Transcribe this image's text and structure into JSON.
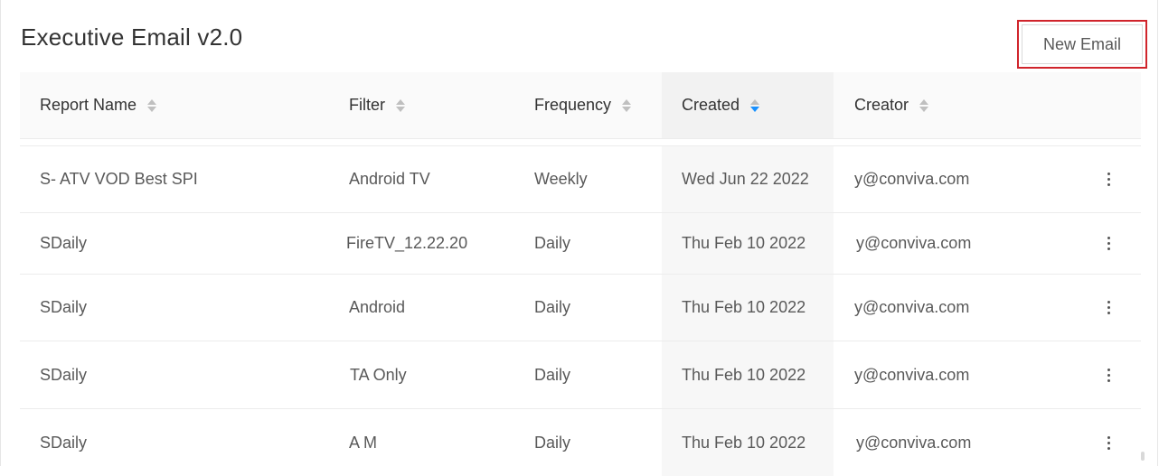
{
  "page": {
    "title": "Executive Email v2.0",
    "new_email_label": "New Email"
  },
  "table": {
    "columns": [
      {
        "label": "Report Name",
        "sortable": true,
        "sorted": false
      },
      {
        "label": "Filter",
        "sortable": true,
        "sorted": false
      },
      {
        "label": "Frequency",
        "sortable": true,
        "sorted": false
      },
      {
        "label": "Created",
        "sortable": true,
        "sorted": "descending"
      },
      {
        "label": "Creator",
        "sortable": true,
        "sorted": false
      }
    ],
    "rows": [
      {
        "name": "S- ATV VOD Best SPI",
        "filter": "Android TV",
        "frequency": "Weekly",
        "created": "Wed Jun 22 2022",
        "creator": "y@conviva.com"
      },
      {
        "name": "SDaily",
        "filter": "FireTV_12.22.20",
        "frequency": "Daily",
        "created": "Thu Feb 10 2022",
        "creator": "y@conviva.com"
      },
      {
        "name": "SDaily",
        "filter": "Android",
        "frequency": "Daily",
        "created": "Thu Feb 10 2022",
        "creator": "y@conviva.com"
      },
      {
        "name": "SDaily",
        "filter": "TA Only",
        "frequency": "Daily",
        "created": "Thu Feb 10 2022",
        "creator": "y@conviva.com"
      },
      {
        "name": "SDaily",
        "filter": "A M",
        "frequency": "Daily",
        "created": "Thu Feb 10 2022",
        "creator": "y@conviva.com"
      }
    ]
  },
  "icons": {
    "sort": "sort-caret-icon",
    "row_menu": "more-vertical-icon"
  },
  "colors": {
    "highlight": "#d0242b",
    "sort_active": "#1890ff"
  }
}
